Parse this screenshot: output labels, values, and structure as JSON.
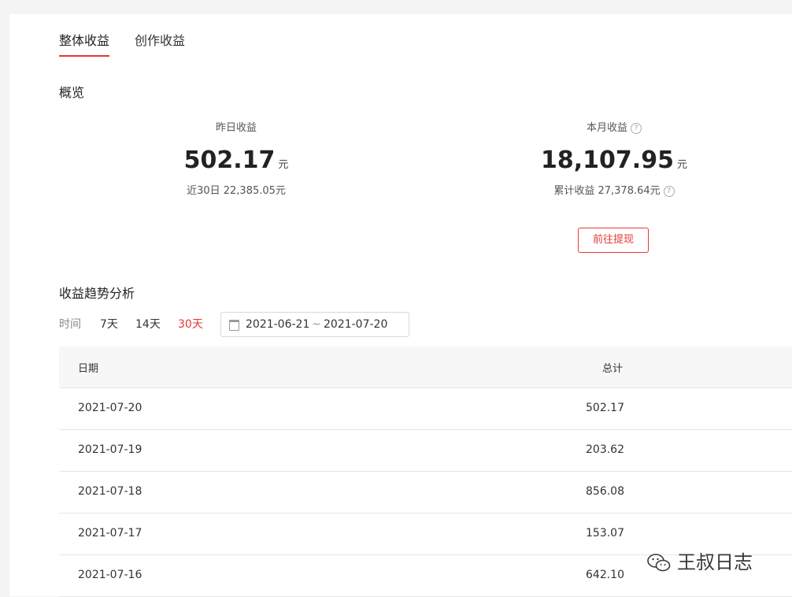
{
  "tabs": [
    {
      "label": "整体收益"
    },
    {
      "label": "创作收益"
    }
  ],
  "overview": {
    "title": "概览",
    "yesterday": {
      "label": "昨日收益",
      "value": "502.17",
      "unit": "元",
      "sub": "近30日 22,385.05元"
    },
    "month": {
      "label": "本月收益",
      "value": "18,107.95",
      "unit": "元",
      "sub": "累计收益 27,378.64元"
    },
    "withdraw_label": "前往提现"
  },
  "trend": {
    "title": "收益趋势分析",
    "time_label": "时间",
    "ranges": [
      "7天",
      "14天",
      "30天"
    ],
    "selected_range": "30天",
    "date_start": "2021-06-21",
    "date_sep": "~",
    "date_end": "2021-07-20"
  },
  "table": {
    "columns": [
      "日期",
      "总计"
    ],
    "rows": [
      {
        "date": "2021-07-20",
        "total": "502.17"
      },
      {
        "date": "2021-07-19",
        "total": "203.62"
      },
      {
        "date": "2021-07-18",
        "total": "856.08"
      },
      {
        "date": "2021-07-17",
        "total": "153.07"
      },
      {
        "date": "2021-07-16",
        "total": "642.10"
      }
    ]
  },
  "watermark": {
    "text": "王叔日志",
    "icon": "wechat-icon"
  },
  "colors": {
    "accent": "#e53935"
  }
}
